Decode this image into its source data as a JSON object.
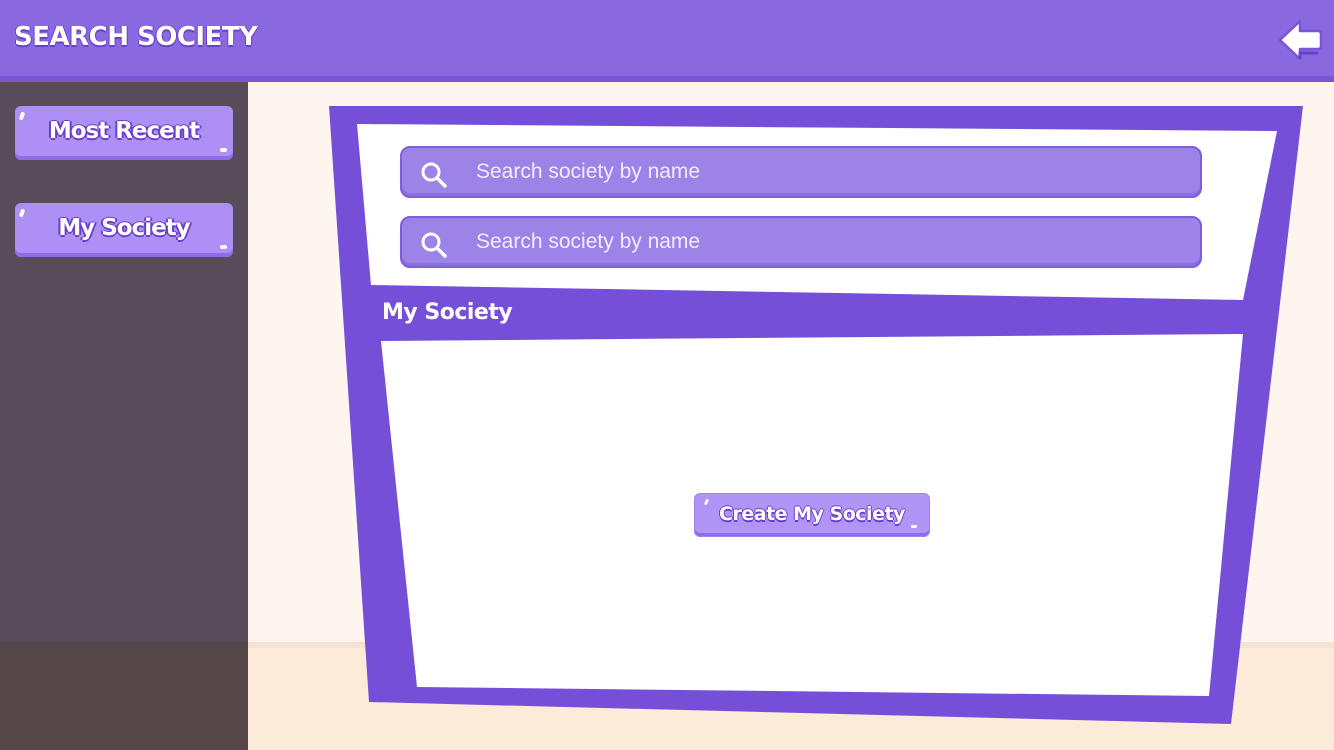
{
  "header": {
    "title": "SEARCH SOCIETY",
    "back_icon": "back-arrow-icon"
  },
  "sidebar": {
    "items": [
      {
        "label": "Most Recent"
      },
      {
        "label": "My Society"
      }
    ]
  },
  "search": {
    "fields": [
      {
        "placeholder": "Search society by name",
        "value": "",
        "icon": "search-icon"
      },
      {
        "placeholder": "Search society by name",
        "value": "",
        "icon": "search-icon"
      }
    ]
  },
  "main": {
    "section_title": "My Society",
    "create_button_label": "Create My Society"
  },
  "colors": {
    "header": "#8968e0",
    "panel_frame": "#764fd8",
    "button": "#ad8ff5",
    "sidebar": "#564c5a",
    "wall": "#fef5ef",
    "floor": "#fdebd9"
  }
}
